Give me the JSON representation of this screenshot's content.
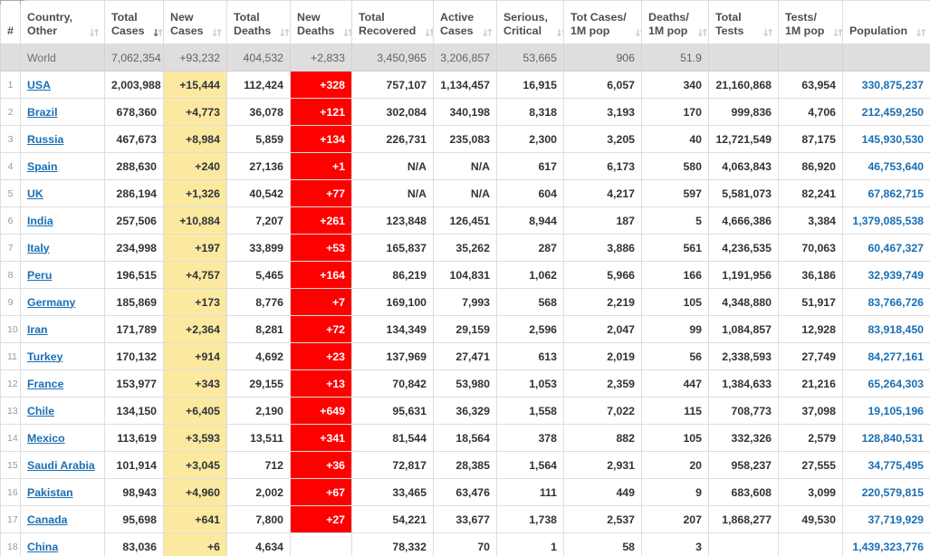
{
  "table": {
    "columns": [
      {
        "key": "rank",
        "label_line1": "#",
        "label_line2": "",
        "sort": "both",
        "align": "center"
      },
      {
        "key": "country",
        "label_line1": "Country,",
        "label_line2": "Other",
        "sort": "both",
        "align": "left"
      },
      {
        "key": "total_cases",
        "label_line1": "Total",
        "label_line2": "Cases",
        "sort": "desc",
        "align": "right"
      },
      {
        "key": "new_cases",
        "label_line1": "New",
        "label_line2": "Cases",
        "sort": "both",
        "align": "right"
      },
      {
        "key": "total_deaths",
        "label_line1": "Total",
        "label_line2": "Deaths",
        "sort": "both",
        "align": "right"
      },
      {
        "key": "new_deaths",
        "label_line1": "New",
        "label_line2": "Deaths",
        "sort": "both",
        "align": "right"
      },
      {
        "key": "total_recovered",
        "label_line1": "Total",
        "label_line2": "Recovered",
        "sort": "both",
        "align": "right"
      },
      {
        "key": "active_cases",
        "label_line1": "Active",
        "label_line2": "Cases",
        "sort": "both",
        "align": "right"
      },
      {
        "key": "serious",
        "label_line1": "Serious,",
        "label_line2": "Critical",
        "sort": "both",
        "align": "right"
      },
      {
        "key": "cases_per_m",
        "label_line1": "Tot Cases/",
        "label_line2": "1M pop",
        "sort": "both",
        "align": "right"
      },
      {
        "key": "deaths_per_m",
        "label_line1": "Deaths/",
        "label_line2": "1M pop",
        "sort": "both",
        "align": "right"
      },
      {
        "key": "total_tests",
        "label_line1": "Total",
        "label_line2": "Tests",
        "sort": "both",
        "align": "right"
      },
      {
        "key": "tests_per_m",
        "label_line1": "Tests/",
        "label_line2": "1M pop",
        "sort": "both",
        "align": "right"
      },
      {
        "key": "population",
        "label_line1": "Population",
        "label_line2": "",
        "sort": "both",
        "align": "right"
      }
    ],
    "icons": {
      "sort": "sort-updown-icon",
      "sort_active": "sort-desc-icon"
    },
    "colors": {
      "new_cases_bg": "#fce9a0",
      "new_deaths_bg": "#ff0000",
      "world_row_bg": "#dedede",
      "link": "#1a6fb5",
      "population": "#1a6fb5"
    },
    "world_row": {
      "rank": "",
      "country": "World",
      "total_cases": "7,062,354",
      "new_cases": "+93,232",
      "total_deaths": "404,532",
      "new_deaths": "+2,833",
      "total_recovered": "3,450,965",
      "active_cases": "3,206,857",
      "serious": "53,665",
      "cases_per_m": "906",
      "deaths_per_m": "51.9",
      "total_tests": "",
      "tests_per_m": "",
      "population": ""
    },
    "rows": [
      {
        "rank": "1",
        "country": "USA",
        "total_cases": "2,003,988",
        "new_cases": "+15,444",
        "total_deaths": "112,424",
        "new_deaths": "+328",
        "total_recovered": "757,107",
        "active_cases": "1,134,457",
        "serious": "16,915",
        "cases_per_m": "6,057",
        "deaths_per_m": "340",
        "total_tests": "21,160,868",
        "tests_per_m": "63,954",
        "population": "330,875,237"
      },
      {
        "rank": "2",
        "country": "Brazil",
        "total_cases": "678,360",
        "new_cases": "+4,773",
        "total_deaths": "36,078",
        "new_deaths": "+121",
        "total_recovered": "302,084",
        "active_cases": "340,198",
        "serious": "8,318",
        "cases_per_m": "3,193",
        "deaths_per_m": "170",
        "total_tests": "999,836",
        "tests_per_m": "4,706",
        "population": "212,459,250"
      },
      {
        "rank": "3",
        "country": "Russia",
        "total_cases": "467,673",
        "new_cases": "+8,984",
        "total_deaths": "5,859",
        "new_deaths": "+134",
        "total_recovered": "226,731",
        "active_cases": "235,083",
        "serious": "2,300",
        "cases_per_m": "3,205",
        "deaths_per_m": "40",
        "total_tests": "12,721,549",
        "tests_per_m": "87,175",
        "population": "145,930,530"
      },
      {
        "rank": "4",
        "country": "Spain",
        "total_cases": "288,630",
        "new_cases": "+240",
        "total_deaths": "27,136",
        "new_deaths": "+1",
        "total_recovered": "N/A",
        "active_cases": "N/A",
        "serious": "617",
        "cases_per_m": "6,173",
        "deaths_per_m": "580",
        "total_tests": "4,063,843",
        "tests_per_m": "86,920",
        "population": "46,753,640"
      },
      {
        "rank": "5",
        "country": "UK",
        "total_cases": "286,194",
        "new_cases": "+1,326",
        "total_deaths": "40,542",
        "new_deaths": "+77",
        "total_recovered": "N/A",
        "active_cases": "N/A",
        "serious": "604",
        "cases_per_m": "4,217",
        "deaths_per_m": "597",
        "total_tests": "5,581,073",
        "tests_per_m": "82,241",
        "population": "67,862,715"
      },
      {
        "rank": "6",
        "country": "India",
        "total_cases": "257,506",
        "new_cases": "+10,884",
        "total_deaths": "7,207",
        "new_deaths": "+261",
        "total_recovered": "123,848",
        "active_cases": "126,451",
        "serious": "8,944",
        "cases_per_m": "187",
        "deaths_per_m": "5",
        "total_tests": "4,666,386",
        "tests_per_m": "3,384",
        "population": "1,379,085,538"
      },
      {
        "rank": "7",
        "country": "Italy",
        "total_cases": "234,998",
        "new_cases": "+197",
        "total_deaths": "33,899",
        "new_deaths": "+53",
        "total_recovered": "165,837",
        "active_cases": "35,262",
        "serious": "287",
        "cases_per_m": "3,886",
        "deaths_per_m": "561",
        "total_tests": "4,236,535",
        "tests_per_m": "70,063",
        "population": "60,467,327"
      },
      {
        "rank": "8",
        "country": "Peru",
        "total_cases": "196,515",
        "new_cases": "+4,757",
        "total_deaths": "5,465",
        "new_deaths": "+164",
        "total_recovered": "86,219",
        "active_cases": "104,831",
        "serious": "1,062",
        "cases_per_m": "5,966",
        "deaths_per_m": "166",
        "total_tests": "1,191,956",
        "tests_per_m": "36,186",
        "population": "32,939,749"
      },
      {
        "rank": "9",
        "country": "Germany",
        "total_cases": "185,869",
        "new_cases": "+173",
        "total_deaths": "8,776",
        "new_deaths": "+7",
        "total_recovered": "169,100",
        "active_cases": "7,993",
        "serious": "568",
        "cases_per_m": "2,219",
        "deaths_per_m": "105",
        "total_tests": "4,348,880",
        "tests_per_m": "51,917",
        "population": "83,766,726"
      },
      {
        "rank": "10",
        "country": "Iran",
        "total_cases": "171,789",
        "new_cases": "+2,364",
        "total_deaths": "8,281",
        "new_deaths": "+72",
        "total_recovered": "134,349",
        "active_cases": "29,159",
        "serious": "2,596",
        "cases_per_m": "2,047",
        "deaths_per_m": "99",
        "total_tests": "1,084,857",
        "tests_per_m": "12,928",
        "population": "83,918,450"
      },
      {
        "rank": "11",
        "country": "Turkey",
        "total_cases": "170,132",
        "new_cases": "+914",
        "total_deaths": "4,692",
        "new_deaths": "+23",
        "total_recovered": "137,969",
        "active_cases": "27,471",
        "serious": "613",
        "cases_per_m": "2,019",
        "deaths_per_m": "56",
        "total_tests": "2,338,593",
        "tests_per_m": "27,749",
        "population": "84,277,161"
      },
      {
        "rank": "12",
        "country": "France",
        "total_cases": "153,977",
        "new_cases": "+343",
        "total_deaths": "29,155",
        "new_deaths": "+13",
        "total_recovered": "70,842",
        "active_cases": "53,980",
        "serious": "1,053",
        "cases_per_m": "2,359",
        "deaths_per_m": "447",
        "total_tests": "1,384,633",
        "tests_per_m": "21,216",
        "population": "65,264,303"
      },
      {
        "rank": "13",
        "country": "Chile",
        "total_cases": "134,150",
        "new_cases": "+6,405",
        "total_deaths": "2,190",
        "new_deaths": "+649",
        "total_recovered": "95,631",
        "active_cases": "36,329",
        "serious": "1,558",
        "cases_per_m": "7,022",
        "deaths_per_m": "115",
        "total_tests": "708,773",
        "tests_per_m": "37,098",
        "population": "19,105,196"
      },
      {
        "rank": "14",
        "country": "Mexico",
        "total_cases": "113,619",
        "new_cases": "+3,593",
        "total_deaths": "13,511",
        "new_deaths": "+341",
        "total_recovered": "81,544",
        "active_cases": "18,564",
        "serious": "378",
        "cases_per_m": "882",
        "deaths_per_m": "105",
        "total_tests": "332,326",
        "tests_per_m": "2,579",
        "population": "128,840,531"
      },
      {
        "rank": "15",
        "country": "Saudi Arabia",
        "total_cases": "101,914",
        "new_cases": "+3,045",
        "total_deaths": "712",
        "new_deaths": "+36",
        "total_recovered": "72,817",
        "active_cases": "28,385",
        "serious": "1,564",
        "cases_per_m": "2,931",
        "deaths_per_m": "20",
        "total_tests": "958,237",
        "tests_per_m": "27,555",
        "population": "34,775,495"
      },
      {
        "rank": "16",
        "country": "Pakistan",
        "total_cases": "98,943",
        "new_cases": "+4,960",
        "total_deaths": "2,002",
        "new_deaths": "+67",
        "total_recovered": "33,465",
        "active_cases": "63,476",
        "serious": "111",
        "cases_per_m": "449",
        "deaths_per_m": "9",
        "total_tests": "683,608",
        "tests_per_m": "3,099",
        "population": "220,579,815"
      },
      {
        "rank": "17",
        "country": "Canada",
        "total_cases": "95,698",
        "new_cases": "+641",
        "total_deaths": "7,800",
        "new_deaths": "+27",
        "total_recovered": "54,221",
        "active_cases": "33,677",
        "serious": "1,738",
        "cases_per_m": "2,537",
        "deaths_per_m": "207",
        "total_tests": "1,868,277",
        "tests_per_m": "49,530",
        "population": "37,719,929"
      },
      {
        "rank": "18",
        "country": "China",
        "total_cases": "83,036",
        "new_cases": "+6",
        "total_deaths": "4,634",
        "new_deaths": "",
        "total_recovered": "78,332",
        "active_cases": "70",
        "serious": "1",
        "cases_per_m": "58",
        "deaths_per_m": "3",
        "total_tests": "",
        "tests_per_m": "",
        "population": "1,439,323,776"
      }
    ]
  }
}
